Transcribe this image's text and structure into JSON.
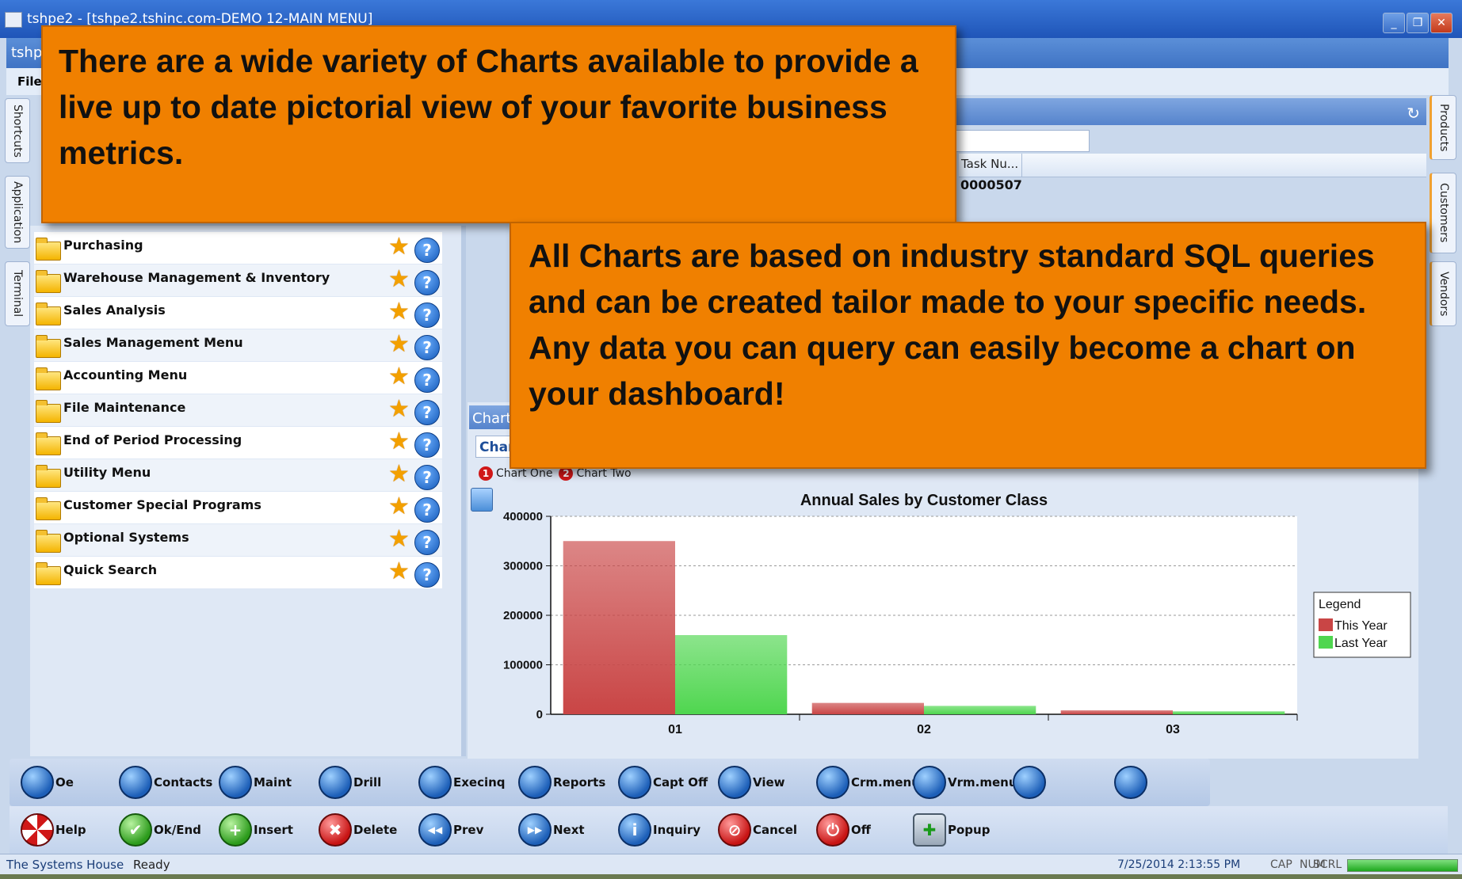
{
  "window": {
    "title": "tshpe2 - [tshpe2.tshinc.com-DEMO 12-MAIN MENU]",
    "tab_label": "tshp",
    "menu_first": "File"
  },
  "side_tabs_left": [
    "Shortcuts",
    "Application",
    "Terminal"
  ],
  "side_tabs_right": [
    "Products",
    "Customers",
    "Vendors"
  ],
  "right_panel": {
    "column_header": "Task Nu...",
    "value": "0000507"
  },
  "menu_items": [
    "Purchasing",
    "Warehouse Management & Inventory",
    "Sales Analysis",
    "Sales Management Menu",
    "Accounting Menu",
    "File Maintenance",
    "End of Period Processing",
    "Utility Menu",
    "Customer Special Programs",
    "Optional Systems",
    "Quick Search"
  ],
  "chart_panel": {
    "tab": "Chart",
    "subtab": "Char",
    "selectors": [
      {
        "num": "1",
        "label": "Chart One"
      },
      {
        "num": "2",
        "label": "Chart Two"
      }
    ]
  },
  "chart_data": {
    "type": "bar",
    "title": "Annual Sales by Customer Class",
    "categories": [
      "01",
      "02",
      "03"
    ],
    "series": [
      {
        "name": "This Year",
        "color": "#c94545",
        "values": [
          350000,
          23000,
          8000
        ]
      },
      {
        "name": "Last Year",
        "color": "#4fd64f",
        "values": [
          160000,
          17000,
          6000
        ]
      }
    ],
    "ylim": [
      0,
      400000
    ],
    "yticks": [
      "0",
      "100000",
      "200000",
      "300000",
      "400000"
    ],
    "legend_title": "Legend",
    "legend_position": "right",
    "grid": true
  },
  "toolbar1": [
    {
      "label": "Oe",
      "icon": "globe-icon"
    },
    {
      "label": "Contacts",
      "icon": "globe-icon"
    },
    {
      "label": "Maint",
      "icon": "globe-icon"
    },
    {
      "label": "Drill",
      "icon": "globe-icon"
    },
    {
      "label": "Execinq",
      "icon": "globe-icon"
    },
    {
      "label": "Reports",
      "icon": "globe-icon"
    },
    {
      "label": "Capt Off",
      "icon": "globe-icon"
    },
    {
      "label": "View",
      "icon": "globe-icon"
    },
    {
      "label": "Crm.menu",
      "icon": "globe-icon"
    },
    {
      "label": "Vrm.menu",
      "icon": "globe-icon"
    },
    {
      "label": "",
      "icon": "globe-icon"
    },
    {
      "label": "",
      "icon": "globe-icon"
    }
  ],
  "toolbar2": [
    {
      "label": "Help",
      "icon": "lifering-icon"
    },
    {
      "label": "Ok/End",
      "icon": "check-icon"
    },
    {
      "label": "Insert",
      "icon": "plus-icon"
    },
    {
      "label": "Delete",
      "icon": "x-icon"
    },
    {
      "label": "Prev",
      "icon": "rewind-icon"
    },
    {
      "label": "Next",
      "icon": "fastforward-icon"
    },
    {
      "label": "Inquiry",
      "icon": "info-icon"
    },
    {
      "label": "Cancel",
      "icon": "cancel-icon"
    },
    {
      "label": "Off",
      "icon": "power-icon"
    },
    {
      "label": "Popup",
      "icon": "popup-icon"
    }
  ],
  "status": {
    "company": "The Systems House",
    "state": "Ready",
    "datetime": "7/25/2014 2:13:55 PM",
    "keys": [
      "CAP",
      "NUM",
      "SCRL"
    ]
  },
  "callouts": {
    "one": "There are a wide variety of Charts available to provide a live up to date pictorial view of your favorite business metrics.",
    "two": "All Charts are based on industry standard SQL queries and can be created tailor made to your specific needs. Any data you can query can easily become a chart on your dashboard!"
  }
}
